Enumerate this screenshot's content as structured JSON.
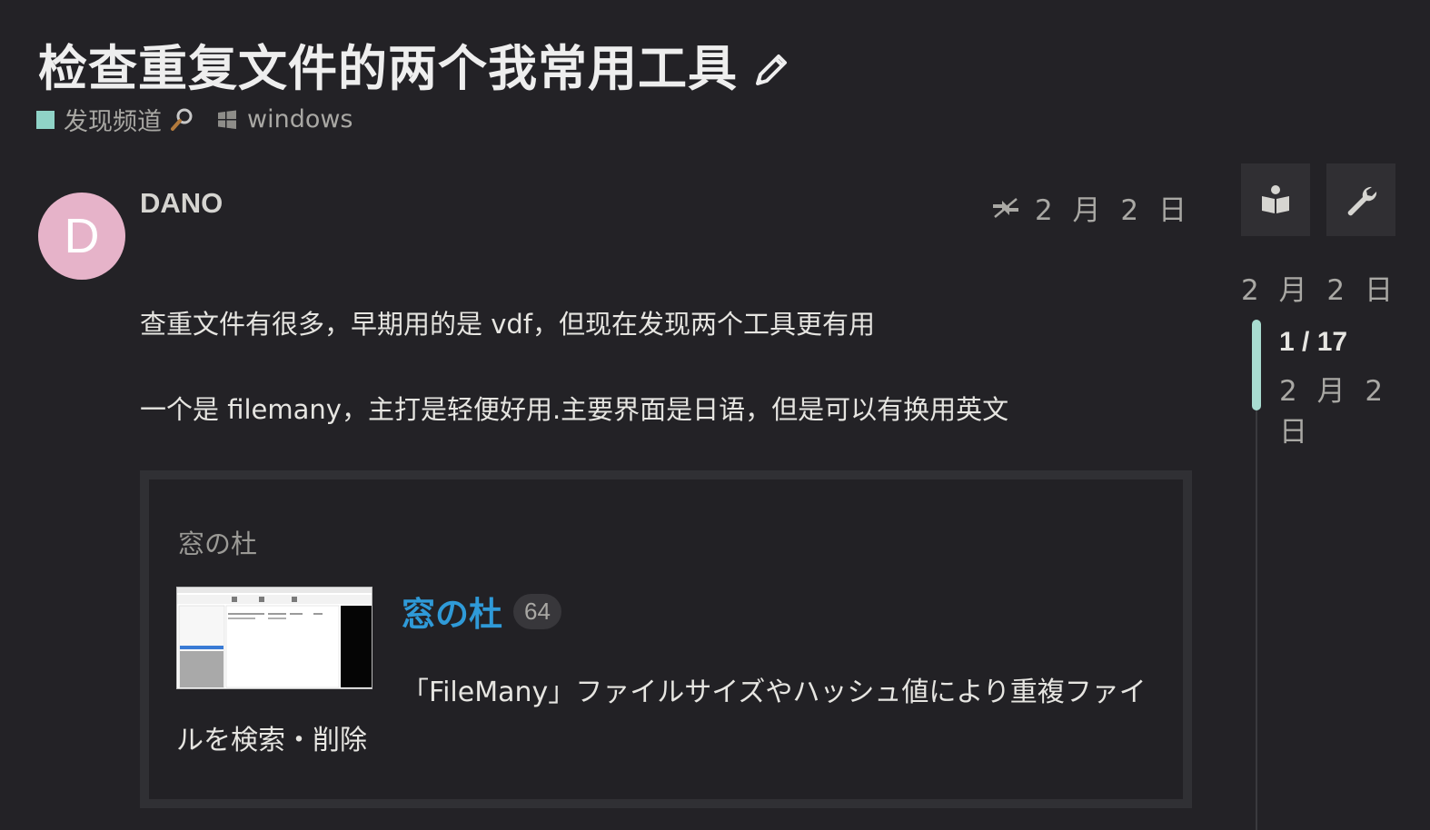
{
  "topic": {
    "title": "检查重复文件的两个我常用工具",
    "category": "发现频道",
    "category_color": "#8fd3c7",
    "tag": "windows",
    "icons": {
      "edit": "pencil-icon",
      "category_emoji": "magnifier-icon",
      "tag": "windows-icon"
    }
  },
  "post": {
    "avatar_letter": "D",
    "avatar_color": "#e6b3c9",
    "username": "DANO",
    "date": "2 月 2 日",
    "paragraphs": [
      "查重文件有很多，早期用的是 vdf，但现在发现两个工具更有用",
      "一个是 filemany，主打是轻便好用.主要界面是日语，但是可以有换用英文"
    ],
    "onebox": {
      "source": "窓の杜",
      "title": "窓の杜",
      "clicks": "64",
      "description": "「FileMany」ファイルサイズやハッシュ値により重複ファイルを検索・削除",
      "link_color": "#2f9ad8"
    }
  },
  "timeline": {
    "top_date": "2 月 2 日",
    "position": "1 / 17",
    "current_date": "2 月 2 日",
    "handle_color": "#a8dcd0"
  },
  "controls": {
    "summarize_icon": "book-reader-icon",
    "admin_icon": "wrench-icon"
  }
}
